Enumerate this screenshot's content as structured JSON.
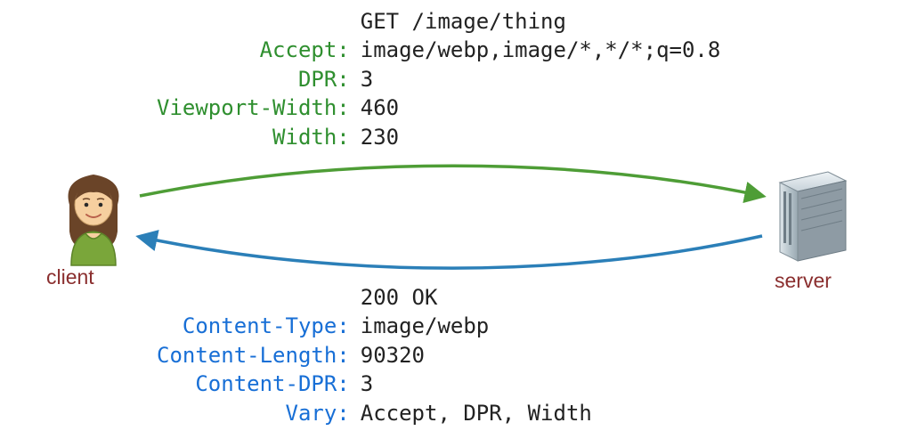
{
  "request": {
    "line": "GET /image/thing",
    "headers": [
      {
        "key": "Accept:",
        "value": "image/webp,image/*,*/*;q=0.8"
      },
      {
        "key": "DPR:",
        "value": "3"
      },
      {
        "key": "Viewport-Width:",
        "value": "460"
      },
      {
        "key": "Width:",
        "value": "230"
      }
    ]
  },
  "response": {
    "line": "200 OK",
    "headers": [
      {
        "key": "Content-Type:",
        "value": "image/webp"
      },
      {
        "key": "Content-Length:",
        "value": "90320"
      },
      {
        "key": "Content-DPR:",
        "value": "3"
      },
      {
        "key": "Vary:",
        "value": "Accept, DPR, Width"
      }
    ]
  },
  "labels": {
    "client": "client",
    "server": "server"
  },
  "colors": {
    "req_key": "#2f8f2f",
    "resp_key": "#186fd6",
    "status_line": "#7a001e",
    "caption": "#8a2e2e",
    "arrow_req": "#4e9d36",
    "arrow_resp": "#2b7fb8"
  }
}
